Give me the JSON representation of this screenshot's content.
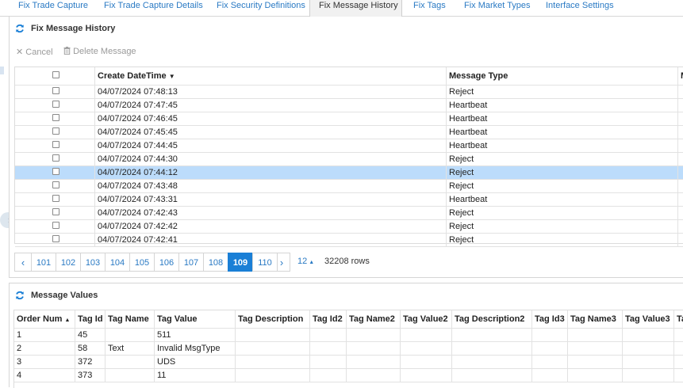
{
  "tabs": [
    {
      "label": "Fix Trade Capture",
      "active": false
    },
    {
      "label": "Fix Trade Capture Details",
      "active": false
    },
    {
      "label": "Fix Security Definitions",
      "active": false
    },
    {
      "label": "Fix Message History",
      "active": true
    },
    {
      "label": "Fix Tags",
      "active": false
    },
    {
      "label": "Fix Market Types",
      "active": false
    },
    {
      "label": "Interface Settings",
      "active": false
    }
  ],
  "history": {
    "title": "Fix Message History",
    "toolbar": {
      "cancel_label": "Cancel",
      "delete_label": "Delete Message"
    },
    "columns": {
      "create": "Create DateTime",
      "type": "Message Type",
      "more": "M"
    },
    "rows": [
      {
        "datetime": "04/07/2024 07:48:13",
        "type": "Reject",
        "selected": false
      },
      {
        "datetime": "04/07/2024 07:47:45",
        "type": "Heartbeat",
        "selected": false
      },
      {
        "datetime": "04/07/2024 07:46:45",
        "type": "Heartbeat",
        "selected": false
      },
      {
        "datetime": "04/07/2024 07:45:45",
        "type": "Heartbeat",
        "selected": false
      },
      {
        "datetime": "04/07/2024 07:44:45",
        "type": "Heartbeat",
        "selected": false
      },
      {
        "datetime": "04/07/2024 07:44:30",
        "type": "Reject",
        "selected": false
      },
      {
        "datetime": "04/07/2024 07:44:12",
        "type": "Reject",
        "selected": true
      },
      {
        "datetime": "04/07/2024 07:43:48",
        "type": "Reject",
        "selected": false
      },
      {
        "datetime": "04/07/2024 07:43:31",
        "type": "Heartbeat",
        "selected": false
      },
      {
        "datetime": "04/07/2024 07:42:43",
        "type": "Reject",
        "selected": false
      },
      {
        "datetime": "04/07/2024 07:42:42",
        "type": "Reject",
        "selected": false
      },
      {
        "datetime": "04/07/2024 07:42:41",
        "type": "Reject",
        "selected": false
      }
    ],
    "pager": {
      "pages": [
        "101",
        "102",
        "103",
        "104",
        "105",
        "106",
        "107",
        "108",
        "109",
        "110"
      ],
      "current": "109",
      "page_size": "12",
      "row_count": "32208 rows"
    }
  },
  "values": {
    "title": "Message Values",
    "columns": [
      "Order Num",
      "Tag Id",
      "Tag Name",
      "Tag Value",
      "Tag Description",
      "Tag Id2",
      "Tag Name2",
      "Tag Value2",
      "Tag Description2",
      "Tag Id3",
      "Tag Name3",
      "Tag Value3",
      "Ta"
    ],
    "rows": [
      [
        "1",
        "45",
        "",
        "511",
        "",
        "",
        "",
        "",
        "",
        "",
        "",
        "",
        ""
      ],
      [
        "2",
        "58",
        "Text",
        "Invalid MsgType",
        "",
        "",
        "",
        "",
        "",
        "",
        "",
        "",
        ""
      ],
      [
        "3",
        "372",
        "",
        "UDS",
        "",
        "",
        "",
        "",
        "",
        "",
        "",
        "",
        ""
      ],
      [
        "4",
        "373",
        "",
        "11",
        "",
        "",
        "",
        "",
        "",
        "",
        "",
        "",
        ""
      ]
    ]
  },
  "colors": {
    "accent": "#1a7fd6",
    "link": "#2a7ac4",
    "selected_row": "#bcdcfb"
  }
}
